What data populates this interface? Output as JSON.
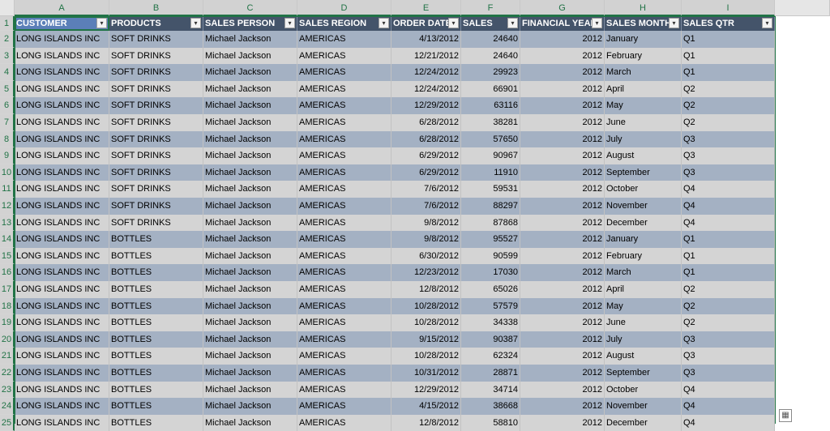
{
  "columns": [
    {
      "letter": "A",
      "header": "CUSTOMER"
    },
    {
      "letter": "B",
      "header": "PRODUCTS"
    },
    {
      "letter": "C",
      "header": "SALES PERSON"
    },
    {
      "letter": "D",
      "header": "SALES REGION"
    },
    {
      "letter": "E",
      "header": "ORDER DATE"
    },
    {
      "letter": "F",
      "header": "SALES"
    },
    {
      "letter": "G",
      "header": "FINANCIAL YEAR"
    },
    {
      "letter": "H",
      "header": "SALES MONTH"
    },
    {
      "letter": "I",
      "header": "SALES QTR"
    }
  ],
  "header_row_number": "1",
  "filter_icon": "dropdown-arrow-icon",
  "rows": [
    {
      "n": "2",
      "cells": [
        "LONG ISLANDS INC",
        "SOFT DRINKS",
        "Michael Jackson",
        "AMERICAS",
        "4/13/2012",
        "24640",
        "2012",
        "January",
        "Q1"
      ]
    },
    {
      "n": "3",
      "cells": [
        "LONG ISLANDS INC",
        "SOFT DRINKS",
        "Michael Jackson",
        "AMERICAS",
        "12/21/2012",
        "24640",
        "2012",
        "February",
        "Q1"
      ]
    },
    {
      "n": "4",
      "cells": [
        "LONG ISLANDS INC",
        "SOFT DRINKS",
        "Michael Jackson",
        "AMERICAS",
        "12/24/2012",
        "29923",
        "2012",
        "March",
        "Q1"
      ]
    },
    {
      "n": "5",
      "cells": [
        "LONG ISLANDS INC",
        "SOFT DRINKS",
        "Michael Jackson",
        "AMERICAS",
        "12/24/2012",
        "66901",
        "2012",
        "April",
        "Q2"
      ]
    },
    {
      "n": "6",
      "cells": [
        "LONG ISLANDS INC",
        "SOFT DRINKS",
        "Michael Jackson",
        "AMERICAS",
        "12/29/2012",
        "63116",
        "2012",
        "May",
        "Q2"
      ]
    },
    {
      "n": "7",
      "cells": [
        "LONG ISLANDS INC",
        "SOFT DRINKS",
        "Michael Jackson",
        "AMERICAS",
        "6/28/2012",
        "38281",
        "2012",
        "June",
        "Q2"
      ]
    },
    {
      "n": "8",
      "cells": [
        "LONG ISLANDS INC",
        "SOFT DRINKS",
        "Michael Jackson",
        "AMERICAS",
        "6/28/2012",
        "57650",
        "2012",
        "July",
        "Q3"
      ]
    },
    {
      "n": "9",
      "cells": [
        "LONG ISLANDS INC",
        "SOFT DRINKS",
        "Michael Jackson",
        "AMERICAS",
        "6/29/2012",
        "90967",
        "2012",
        "August",
        "Q3"
      ]
    },
    {
      "n": "10",
      "cells": [
        "LONG ISLANDS INC",
        "SOFT DRINKS",
        "Michael Jackson",
        "AMERICAS",
        "6/29/2012",
        "11910",
        "2012",
        "September",
        "Q3"
      ]
    },
    {
      "n": "11",
      "cells": [
        "LONG ISLANDS INC",
        "SOFT DRINKS",
        "Michael Jackson",
        "AMERICAS",
        "7/6/2012",
        "59531",
        "2012",
        "October",
        "Q4"
      ]
    },
    {
      "n": "12",
      "cells": [
        "LONG ISLANDS INC",
        "SOFT DRINKS",
        "Michael Jackson",
        "AMERICAS",
        "7/6/2012",
        "88297",
        "2012",
        "November",
        "Q4"
      ]
    },
    {
      "n": "13",
      "cells": [
        "LONG ISLANDS INC",
        "SOFT DRINKS",
        "Michael Jackson",
        "AMERICAS",
        "9/8/2012",
        "87868",
        "2012",
        "December",
        "Q4"
      ]
    },
    {
      "n": "14",
      "cells": [
        "LONG ISLANDS INC",
        "BOTTLES",
        "Michael Jackson",
        "AMERICAS",
        "9/8/2012",
        "95527",
        "2012",
        "January",
        "Q1"
      ]
    },
    {
      "n": "15",
      "cells": [
        "LONG ISLANDS INC",
        "BOTTLES",
        "Michael Jackson",
        "AMERICAS",
        "6/30/2012",
        "90599",
        "2012",
        "February",
        "Q1"
      ]
    },
    {
      "n": "16",
      "cells": [
        "LONG ISLANDS INC",
        "BOTTLES",
        "Michael Jackson",
        "AMERICAS",
        "12/23/2012",
        "17030",
        "2012",
        "March",
        "Q1"
      ]
    },
    {
      "n": "17",
      "cells": [
        "LONG ISLANDS INC",
        "BOTTLES",
        "Michael Jackson",
        "AMERICAS",
        "12/8/2012",
        "65026",
        "2012",
        "April",
        "Q2"
      ]
    },
    {
      "n": "18",
      "cells": [
        "LONG ISLANDS INC",
        "BOTTLES",
        "Michael Jackson",
        "AMERICAS",
        "10/28/2012",
        "57579",
        "2012",
        "May",
        "Q2"
      ]
    },
    {
      "n": "19",
      "cells": [
        "LONG ISLANDS INC",
        "BOTTLES",
        "Michael Jackson",
        "AMERICAS",
        "10/28/2012",
        "34338",
        "2012",
        "June",
        "Q2"
      ]
    },
    {
      "n": "20",
      "cells": [
        "LONG ISLANDS INC",
        "BOTTLES",
        "Michael Jackson",
        "AMERICAS",
        "9/15/2012",
        "90387",
        "2012",
        "July",
        "Q3"
      ]
    },
    {
      "n": "21",
      "cells": [
        "LONG ISLANDS INC",
        "BOTTLES",
        "Michael Jackson",
        "AMERICAS",
        "10/28/2012",
        "62324",
        "2012",
        "August",
        "Q3"
      ]
    },
    {
      "n": "22",
      "cells": [
        "LONG ISLANDS INC",
        "BOTTLES",
        "Michael Jackson",
        "AMERICAS",
        "10/31/2012",
        "28871",
        "2012",
        "September",
        "Q3"
      ]
    },
    {
      "n": "23",
      "cells": [
        "LONG ISLANDS INC",
        "BOTTLES",
        "Michael Jackson",
        "AMERICAS",
        "12/29/2012",
        "34714",
        "2012",
        "October",
        "Q4"
      ]
    },
    {
      "n": "24",
      "cells": [
        "LONG ISLANDS INC",
        "BOTTLES",
        "Michael Jackson",
        "AMERICAS",
        "4/15/2012",
        "38668",
        "2012",
        "November",
        "Q4"
      ]
    },
    {
      "n": "25",
      "cells": [
        "LONG ISLANDS INC",
        "BOTTLES",
        "Michael Jackson",
        "AMERICAS",
        "12/8/2012",
        "58810",
        "2012",
        "December",
        "Q4"
      ]
    }
  ],
  "quick_analysis_icon": "quick-analysis-icon",
  "colors": {
    "header_fill": "#44546a",
    "band_dark": "#a4b1c3",
    "band_light": "#d4d4d4",
    "selection": "#217346"
  }
}
